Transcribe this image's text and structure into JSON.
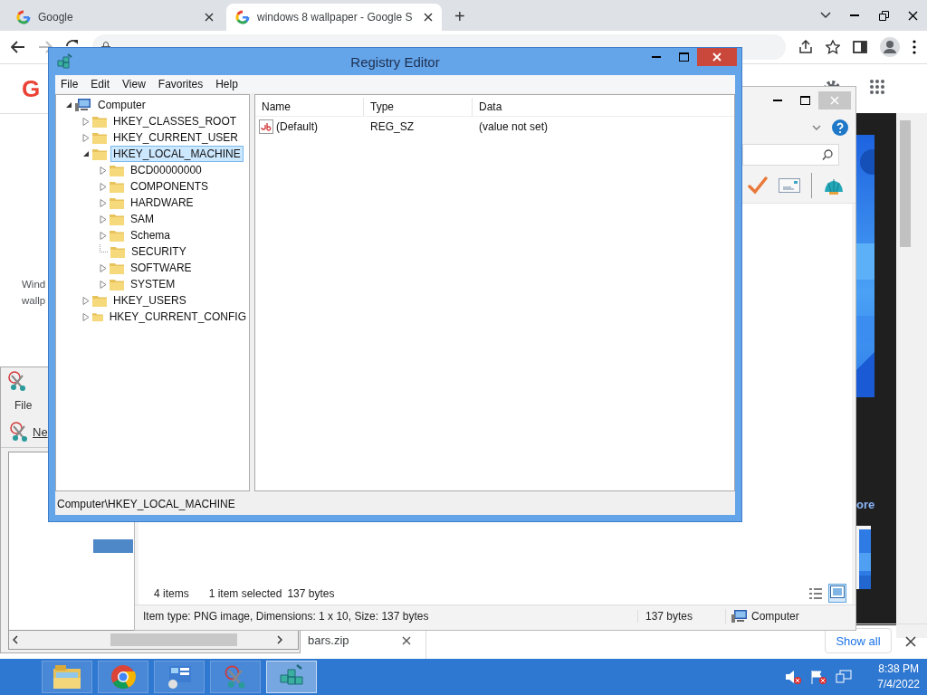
{
  "browser": {
    "tabs": [
      {
        "title": "Google",
        "selected": false
      },
      {
        "title": "windows 8 wallpaper - Google S",
        "selected": true
      }
    ],
    "new_tab_label": "+",
    "page": {
      "logo_letter": "G",
      "snippet_lines": [
        "Wind",
        "wallp"
      ],
      "more_link": "ore"
    },
    "downloads": {
      "file": "bars.zip",
      "show_all": "Show all"
    }
  },
  "snipping_tool": {
    "menu": [
      "File"
    ],
    "new_button": "Ne"
  },
  "explorer": {
    "item_count": "4 items",
    "selection": "1 item selected",
    "selection_size": "137 bytes",
    "details": "Item type: PNG image, Dimensions: 1 x 10, Size: 137 bytes",
    "size": "137 bytes",
    "location": "Computer"
  },
  "registry_editor": {
    "title": "Registry Editor",
    "menu": [
      "File",
      "Edit",
      "View",
      "Favorites",
      "Help"
    ],
    "tree": [
      {
        "label": "Computer",
        "kind": "computer",
        "expandable": true,
        "expanded": true,
        "selected": false,
        "children": [
          {
            "label": "HKEY_CLASSES_ROOT",
            "kind": "folder",
            "expandable": true,
            "expanded": false,
            "selected": false
          },
          {
            "label": "HKEY_CURRENT_USER",
            "kind": "folder",
            "expandable": true,
            "expanded": false,
            "selected": false
          },
          {
            "label": "HKEY_LOCAL_MACHINE",
            "kind": "folder",
            "expandable": true,
            "expanded": true,
            "selected": true,
            "children": [
              {
                "label": "BCD00000000",
                "kind": "folder",
                "expandable": true,
                "expanded": false,
                "selected": false
              },
              {
                "label": "COMPONENTS",
                "kind": "folder",
                "expandable": true,
                "expanded": false,
                "selected": false
              },
              {
                "label": "HARDWARE",
                "kind": "folder",
                "expandable": true,
                "expanded": false,
                "selected": false
              },
              {
                "label": "SAM",
                "kind": "folder",
                "expandable": true,
                "expanded": false,
                "selected": false
              },
              {
                "label": "Schema",
                "kind": "folder",
                "expandable": true,
                "expanded": false,
                "selected": false
              },
              {
                "label": "SECURITY",
                "kind": "folder",
                "expandable": false,
                "selected": false
              },
              {
                "label": "SOFTWARE",
                "kind": "folder",
                "expandable": true,
                "expanded": false,
                "selected": false
              },
              {
                "label": "SYSTEM",
                "kind": "folder",
                "expandable": true,
                "expanded": false,
                "selected": false
              }
            ]
          },
          {
            "label": "HKEY_USERS",
            "kind": "folder",
            "expandable": true,
            "expanded": false,
            "selected": false
          },
          {
            "label": "HKEY_CURRENT_CONFIG",
            "kind": "folder",
            "expandable": true,
            "expanded": false,
            "selected": false
          }
        ]
      }
    ],
    "columns": [
      "Name",
      "Type",
      "Data"
    ],
    "values": [
      {
        "name": "(Default)",
        "type": "REG_SZ",
        "data": "(value not set)"
      }
    ],
    "status": "Computer\\HKEY_LOCAL_MACHINE"
  },
  "taskbar": {
    "apps": [
      {
        "kind": "files",
        "selected": false
      },
      {
        "kind": "browser",
        "selected": false
      },
      {
        "kind": "panel",
        "selected": false
      },
      {
        "kind": "scissors",
        "selected": false
      },
      {
        "kind": "registry",
        "selected": true
      }
    ],
    "time": "8:38 PM",
    "date": "7/4/2022"
  }
}
